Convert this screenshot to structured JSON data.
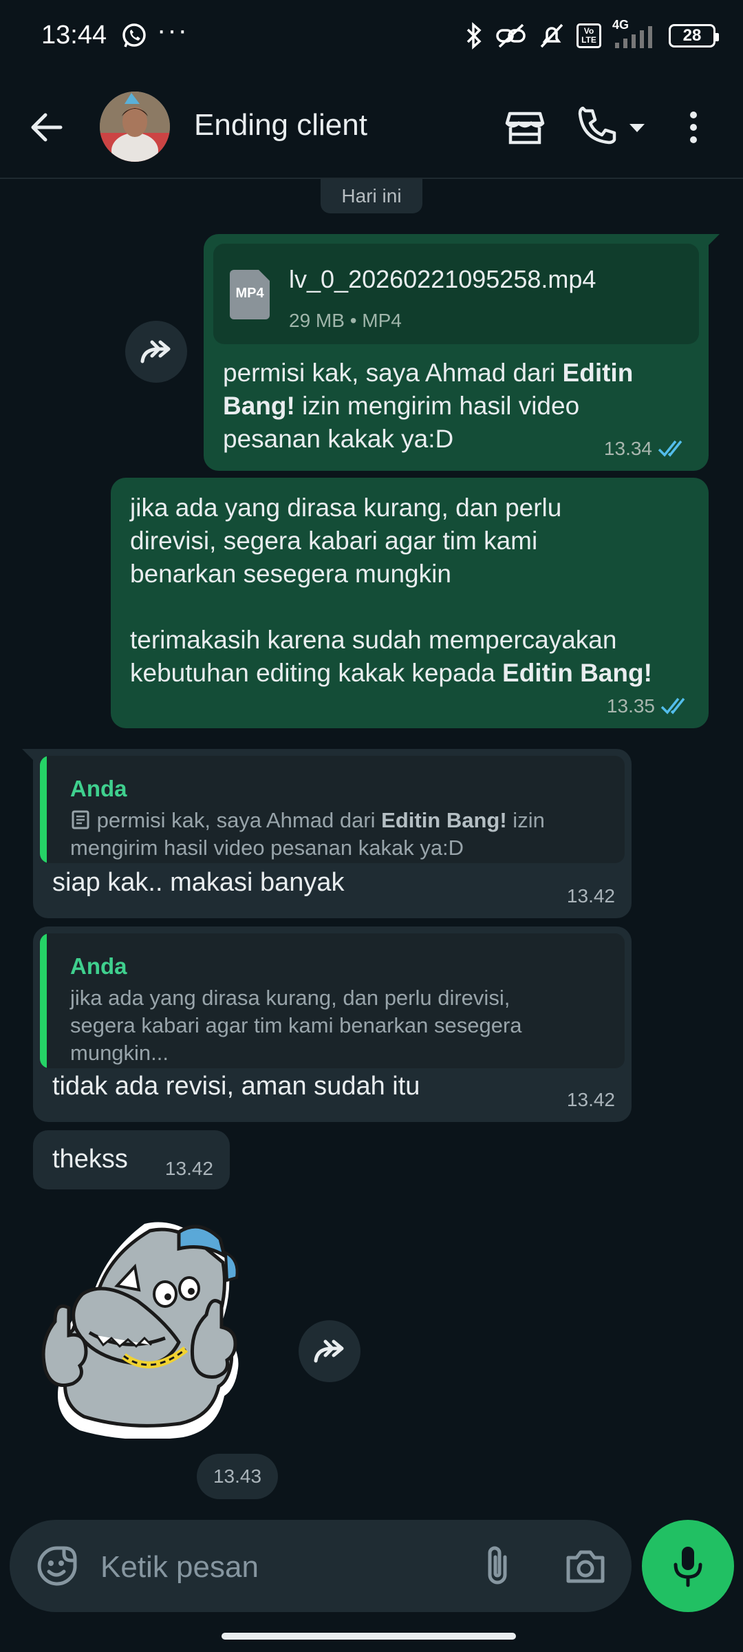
{
  "status_bar": {
    "time": "13:44",
    "dots": "···",
    "lte_label": "Vo LTE",
    "network": "4G",
    "battery": "28"
  },
  "header": {
    "contact_name": "Ending client"
  },
  "chat": {
    "date_chip": "Hari ini",
    "messages": [
      {
        "file_name": "lv_0_20260221095258.mp4",
        "file_meta": "29 MB • MP4",
        "file_type": "MP4",
        "caption_a": "permisi kak, saya Ahmad dari ",
        "caption_b": "Editin",
        "caption_c": "Bang!",
        "caption_d": " izin mengirim hasil video",
        "caption_e": "pesanan kakak ya:D",
        "time": "13.34"
      },
      {
        "line1": "jika ada yang dirasa kurang, dan perlu",
        "line2": "direvisi, segera kabari agar tim kami",
        "line3": "benarkan sesegera mungkin",
        "line4": "terimakasih karena sudah mempercayakan",
        "line5a": "kebutuhan editing kakak kepada ",
        "line5b": "Editin Bang!",
        "time": "13.35"
      },
      {
        "quote_author": "Anda",
        "quote_a": "permisi kak, saya Ahmad dari ",
        "quote_b": "Editin Bang!",
        "quote_c": " izin",
        "quote_d": "mengirim hasil video pesanan kakak ya:D",
        "text": "siap kak.. makasi banyak",
        "time": "13.42"
      },
      {
        "quote_author": "Anda",
        "quote_line1": "jika ada yang dirasa kurang, dan perlu direvisi,",
        "quote_line2": "segera kabari agar tim kami benarkan sesegera",
        "quote_line3": "mungkin...",
        "text": "tidak ada revisi, aman sudah itu",
        "time": "13.42"
      },
      {
        "text": "thekss",
        "time": "13.42"
      },
      {
        "time": "13.43"
      }
    ]
  },
  "input": {
    "placeholder": "Ketik pesan"
  },
  "colors": {
    "background": "#0b141a",
    "outgoing_bubble": "#144d37",
    "incoming_bubble": "#1f2c33",
    "accent_green": "#21c063",
    "read_ticks": "#53bdeb"
  }
}
